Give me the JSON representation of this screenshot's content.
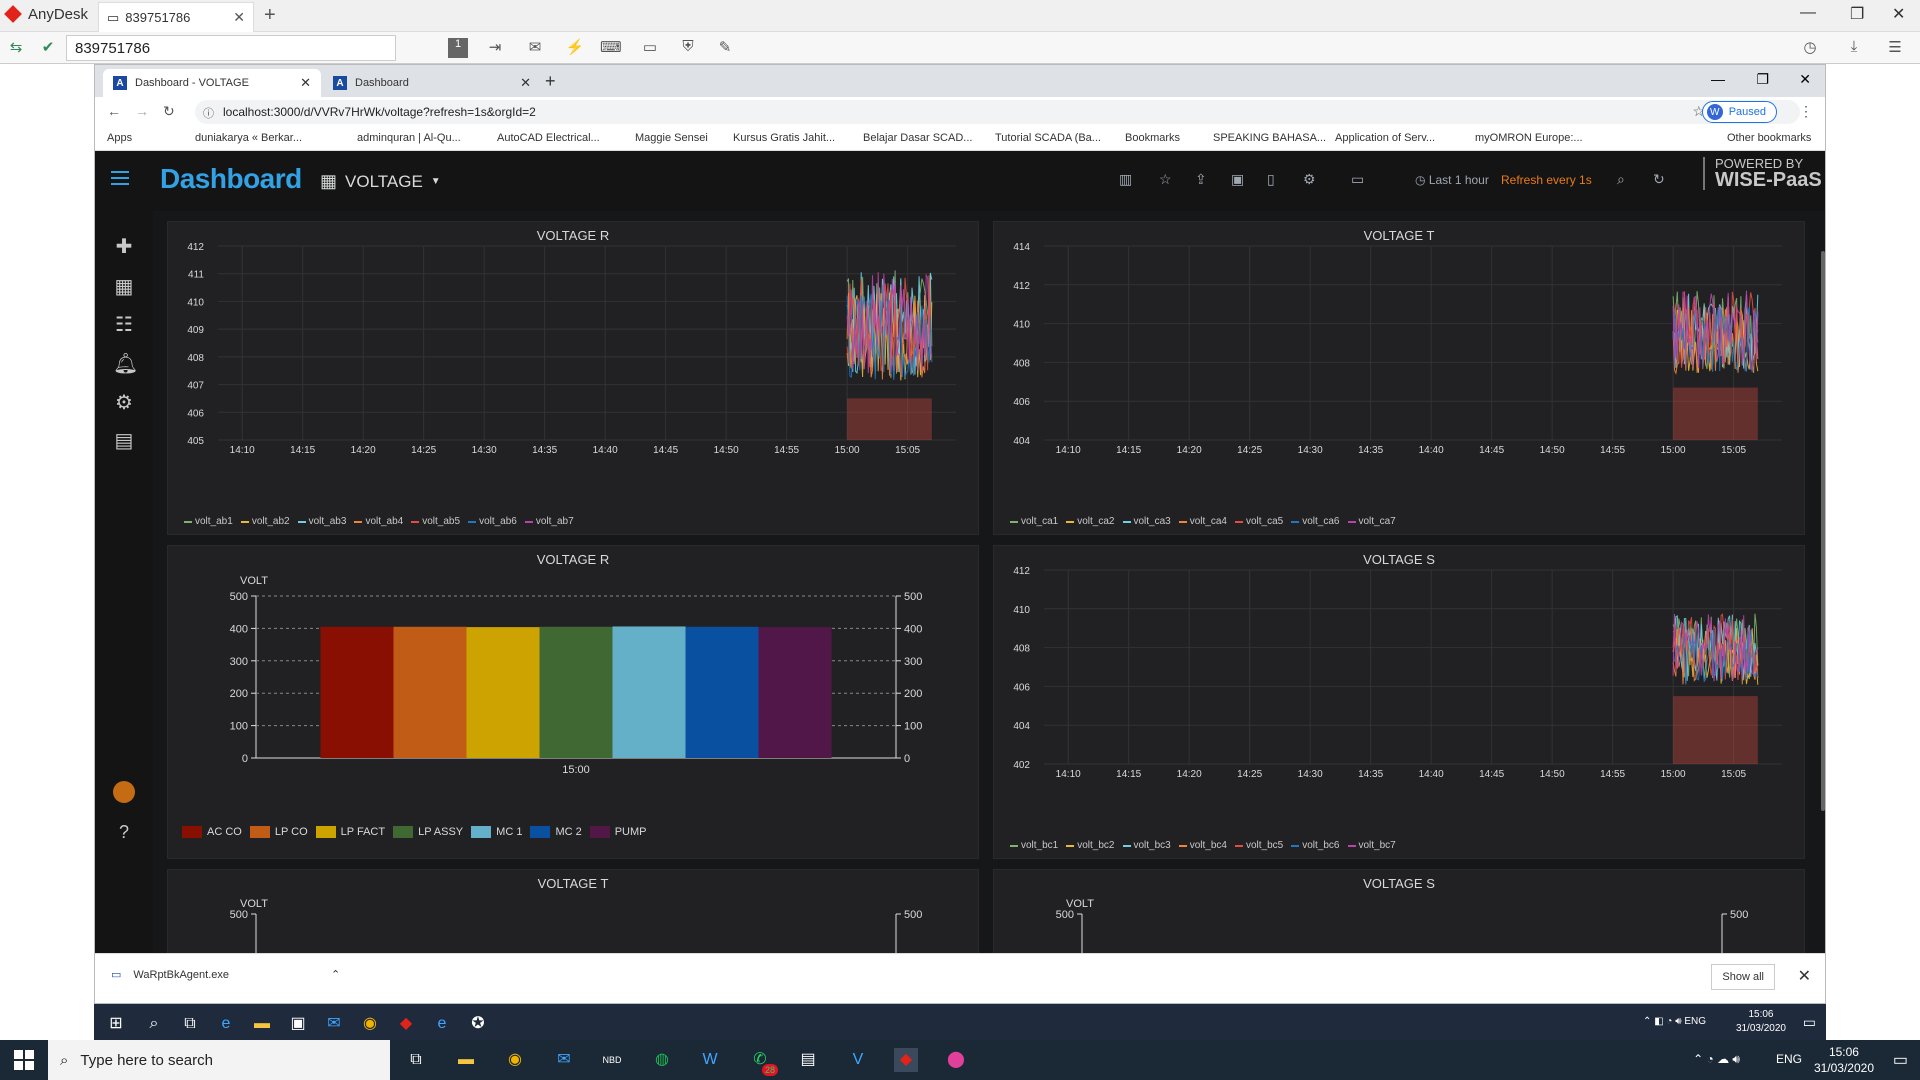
{
  "anydesk": {
    "app_name": "AnyDesk",
    "tab_label": "839751786",
    "address": "839751786"
  },
  "browser": {
    "tabs": [
      {
        "label": "Dashboard - VOLTAGE"
      },
      {
        "label": "Dashboard"
      }
    ],
    "url": "localhost:3000/d/VVRv7HrWk/voltage?refresh=1s&orgId=2",
    "paused_label": "Paused",
    "profile_initial": "W",
    "bookmarks": [
      "Apps",
      "duniakarya « Berkar...",
      "adminquran | Al-Qu...",
      "AutoCAD Electrical...",
      "Maggie Sensei",
      "Kursus Gratis Jahit...",
      "Belajar Dasar SCAD...",
      "Tutorial SCADA (Ba...",
      "Bookmarks",
      "SPEAKING BAHASA...",
      "Application of Serv...",
      "myOMRON Europe:..."
    ],
    "other_bookmarks": "Other bookmarks"
  },
  "grafana": {
    "title": "Dashboard",
    "dashboard_name": "VOLTAGE",
    "time_range": "Last 1 hour",
    "refresh": "Refresh every 1s",
    "powered_by": "POWERED BY",
    "brand": "WISE-PaaS",
    "colors": {
      "accent": "#33a2e5",
      "refresh": "#eb7b18",
      "panel_bg": "#212124"
    }
  },
  "panels": {
    "p1": {
      "title": "VOLTAGE R",
      "legend": [
        "volt_ab1",
        "volt_ab2",
        "volt_ab3",
        "volt_ab4",
        "volt_ab5",
        "volt_ab6",
        "volt_ab7"
      ]
    },
    "p2": {
      "title": "VOLTAGE T",
      "legend": [
        "volt_ca1",
        "volt_ca2",
        "volt_ca3",
        "volt_ca4",
        "volt_ca5",
        "volt_ca6",
        "volt_ca7"
      ]
    },
    "p3": {
      "title": "VOLTAGE R",
      "legend": [
        "AC CO",
        "LP CO",
        "LP FACT",
        "LP ASSY",
        "MC 1",
        "MC 2",
        "PUMP"
      ]
    },
    "p4": {
      "title": "VOLTAGE S",
      "legend": [
        "volt_bc1",
        "volt_bc2",
        "volt_bc3",
        "volt_bc4",
        "volt_bc5",
        "volt_bc6",
        "volt_bc7"
      ]
    },
    "p5": {
      "title": "VOLTAGE T",
      "ylabel": "VOLT"
    },
    "p6": {
      "title": "VOLTAGE S",
      "ylabel": "VOLT"
    }
  },
  "chart_data": [
    {
      "type": "line",
      "title": "VOLTAGE R",
      "x_ticks": [
        "14:10",
        "14:15",
        "14:20",
        "14:25",
        "14:30",
        "14:35",
        "14:40",
        "14:45",
        "14:50",
        "14:55",
        "15:00",
        "15:05"
      ],
      "y_ticks": [
        405,
        406,
        407,
        408,
        409,
        410,
        411,
        412
      ],
      "ylim": [
        405,
        412
      ],
      "data_x_range": [
        "15:00",
        "15:07"
      ],
      "series_band": [
        406.0,
        411.4
      ],
      "series": [
        {
          "name": "volt_ab1",
          "color": "#7eb26d"
        },
        {
          "name": "volt_ab2",
          "color": "#eab839"
        },
        {
          "name": "volt_ab3",
          "color": "#6ed0e0"
        },
        {
          "name": "volt_ab4",
          "color": "#ef843c"
        },
        {
          "name": "volt_ab5",
          "color": "#e24d42"
        },
        {
          "name": "volt_ab6",
          "color": "#1f78c1"
        },
        {
          "name": "volt_ab7",
          "color": "#ba43a9"
        }
      ]
    },
    {
      "type": "line",
      "title": "VOLTAGE T",
      "x_ticks": [
        "14:10",
        "14:15",
        "14:20",
        "14:25",
        "14:30",
        "14:35",
        "14:40",
        "14:45",
        "14:50",
        "14:55",
        "15:00",
        "15:05"
      ],
      "y_ticks": [
        404,
        406,
        408,
        410,
        412,
        414
      ],
      "ylim": [
        404,
        414
      ],
      "data_x_range": [
        "15:00",
        "15:07"
      ],
      "series_band": [
        406.2,
        412.0
      ],
      "series": [
        {
          "name": "volt_ca1",
          "color": "#7eb26d"
        },
        {
          "name": "volt_ca2",
          "color": "#eab839"
        },
        {
          "name": "volt_ca3",
          "color": "#6ed0e0"
        },
        {
          "name": "volt_ca4",
          "color": "#ef843c"
        },
        {
          "name": "volt_ca5",
          "color": "#e24d42"
        },
        {
          "name": "volt_ca6",
          "color": "#1f78c1"
        },
        {
          "name": "volt_ca7",
          "color": "#ba43a9"
        }
      ]
    },
    {
      "type": "bar",
      "title": "VOLTAGE R",
      "ylabel": "VOLT",
      "x_tick": "15:00",
      "ylim": [
        0,
        500
      ],
      "y_ticks": [
        0,
        100,
        200,
        300,
        400,
        500
      ],
      "categories": [
        "AC CO",
        "LP CO",
        "LP FACT",
        "LP ASSY",
        "MC 1",
        "MC 2",
        "PUMP"
      ],
      "values": [
        405,
        405,
        404,
        405,
        406,
        405,
        404
      ],
      "colors": [
        "#890f02",
        "#c15c17",
        "#cca300",
        "#3f6833",
        "#64b0c8",
        "#0a50a1",
        "#511749"
      ]
    },
    {
      "type": "line",
      "title": "VOLTAGE S",
      "x_ticks": [
        "14:10",
        "14:15",
        "14:20",
        "14:25",
        "14:30",
        "14:35",
        "14:40",
        "14:45",
        "14:50",
        "14:55",
        "15:00",
        "15:05"
      ],
      "y_ticks": [
        402,
        404,
        406,
        408,
        410,
        412
      ],
      "ylim": [
        402,
        412
      ],
      "data_x_range": [
        "15:00",
        "15:07"
      ],
      "series_band": [
        405.0,
        410.0
      ],
      "series": [
        {
          "name": "volt_bc1",
          "color": "#7eb26d"
        },
        {
          "name": "volt_bc2",
          "color": "#eab839"
        },
        {
          "name": "volt_bc3",
          "color": "#6ed0e0"
        },
        {
          "name": "volt_bc4",
          "color": "#ef843c"
        },
        {
          "name": "volt_bc5",
          "color": "#e24d42"
        },
        {
          "name": "volt_bc6",
          "color": "#1f78c1"
        },
        {
          "name": "volt_bc7",
          "color": "#ba43a9"
        }
      ]
    }
  ],
  "download": {
    "filename": "WaRptBkAgent.exe",
    "show_all": "Show all"
  },
  "inner_taskbar": {
    "lang": "ENG",
    "time": "15:06",
    "date": "31/03/2020"
  },
  "taskbar": {
    "search_placeholder": "Type here to search",
    "lang": "ENG",
    "time": "15:06",
    "date": "31/03/2020",
    "whatsapp_badge": "28"
  }
}
